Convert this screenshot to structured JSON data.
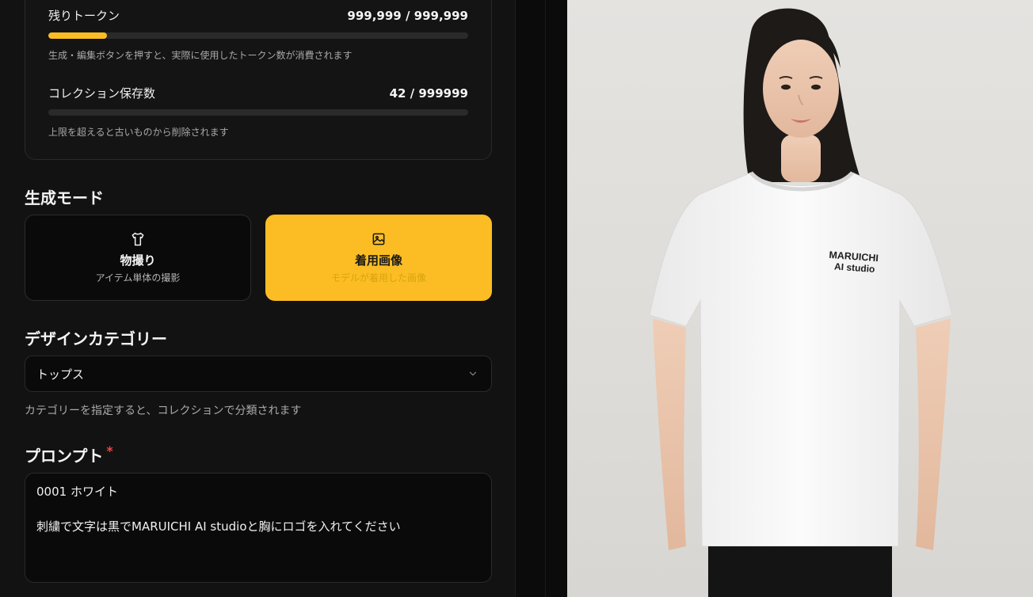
{
  "usage": {
    "tokens": {
      "label": "残りトークン",
      "value": "999,999 / 999,999",
      "fill_fraction": 0.14,
      "hint": "生成・編集ボタンを押すと、実際に使用したトークン数が消費されます"
    },
    "collection": {
      "label": "コレクション保存数",
      "value": "42 / 999999",
      "fill_fraction": 0.0,
      "hint": "上限を超えると古いものから削除されます"
    }
  },
  "mode": {
    "title": "生成モード",
    "options": [
      {
        "icon": "shirt-icon",
        "title": "物撮り",
        "subtitle": "アイテム単体の撮影",
        "selected": false
      },
      {
        "icon": "image-icon",
        "title": "着用画像",
        "subtitle": "モデルが着用した画像",
        "selected": true
      }
    ]
  },
  "category": {
    "title": "デザインカテゴリー",
    "selected": "トップス",
    "hint": "カテゴリーを指定すると、コレクションで分類されます"
  },
  "prompt": {
    "title": "プロンプト",
    "required_mark": "*",
    "lines": [
      "0001 ホワイト",
      "",
      "刺繍で文字は黒でMARUICHI AI studioと胸にロゴを入れてください"
    ]
  },
  "preview": {
    "shirt_text_line1": "MARUICHI",
    "shirt_text_line2": "AI studio"
  },
  "colors": {
    "accent": "#fbbd23",
    "panel_bg": "#121212",
    "card_bg": "#0a0a0a",
    "required": "#ef4444"
  }
}
